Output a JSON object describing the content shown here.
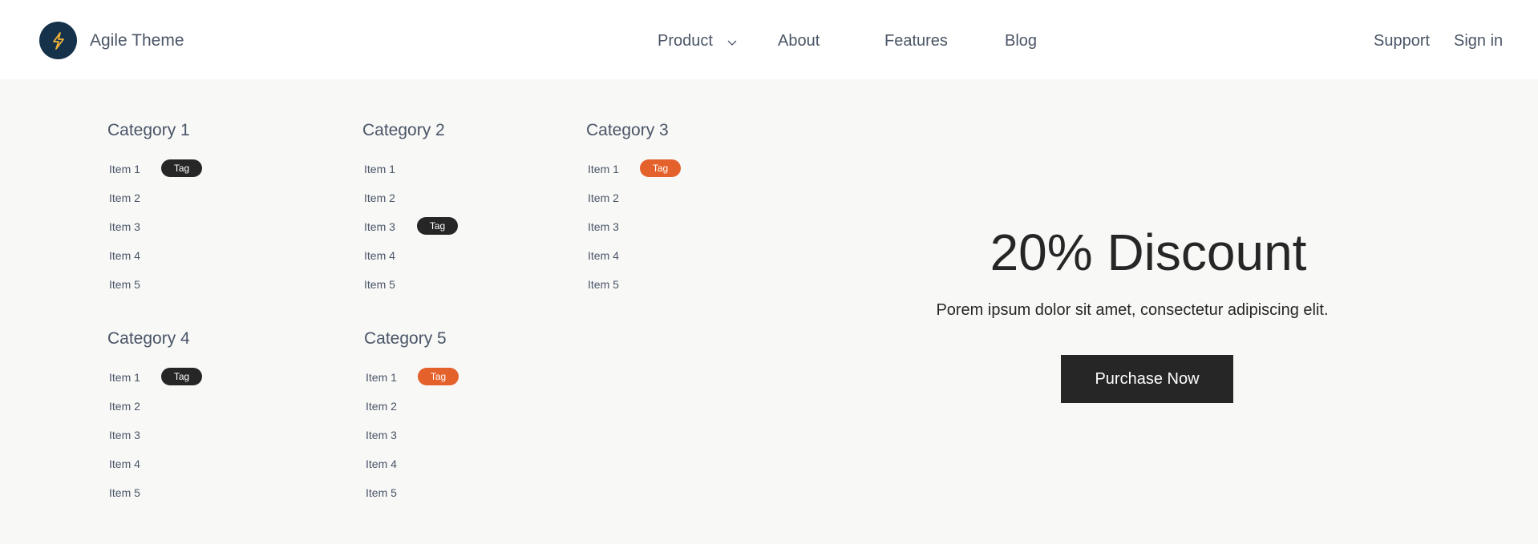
{
  "brand": {
    "name": "Agile Theme",
    "logo_icon": "lightning-bolt-icon",
    "logo_bg": "#16324a",
    "logo_accent": "#f2b53a"
  },
  "nav": {
    "product": "Product",
    "about": "About",
    "features": "Features",
    "blog": "Blog",
    "product_chevron_icon": "chevron-down-icon"
  },
  "header_right": {
    "support": "Support",
    "signin": "Sign in"
  },
  "categories": [
    {
      "title": "Category 1",
      "items": [
        "Item 1",
        "Item 2",
        "Item 3",
        "Item 4",
        "Item 5"
      ],
      "tags": [
        {
          "item": "Item 1",
          "label": "Tag",
          "color": "#262626"
        }
      ]
    },
    {
      "title": "Category 2",
      "items": [
        "Item 1",
        "Item 2",
        "Item 3",
        "Item 4",
        "Item 5"
      ],
      "tags": [
        {
          "item": "Item 3",
          "label": "Tag",
          "color": "#262626"
        }
      ]
    },
    {
      "title": "Category 3",
      "items": [
        "Item 1",
        "Item 2",
        "Item 3",
        "Item 4",
        "Item 5"
      ],
      "tags": [
        {
          "item": "Item 1",
          "label": "Tag",
          "color": "#e5612b"
        }
      ]
    },
    {
      "title": "Category 4",
      "items": [
        "Item 1",
        "Item 2",
        "Item 3",
        "Item 4",
        "Item 5"
      ],
      "tags": [
        {
          "item": "Item 1",
          "label": "Tag",
          "color": "#262626"
        }
      ]
    },
    {
      "title": "Category 5",
      "items": [
        "Item 1",
        "Item 2",
        "Item 3",
        "Item 4",
        "Item 5"
      ],
      "tags": [
        {
          "item": "Item 1",
          "label": "Tag",
          "color": "#e5612b"
        }
      ]
    }
  ],
  "promo": {
    "title": "20% Discount",
    "subtitle": "Porem ipsum dolor sit amet, consectetur adipiscing elit.",
    "button": "Purchase Now"
  }
}
